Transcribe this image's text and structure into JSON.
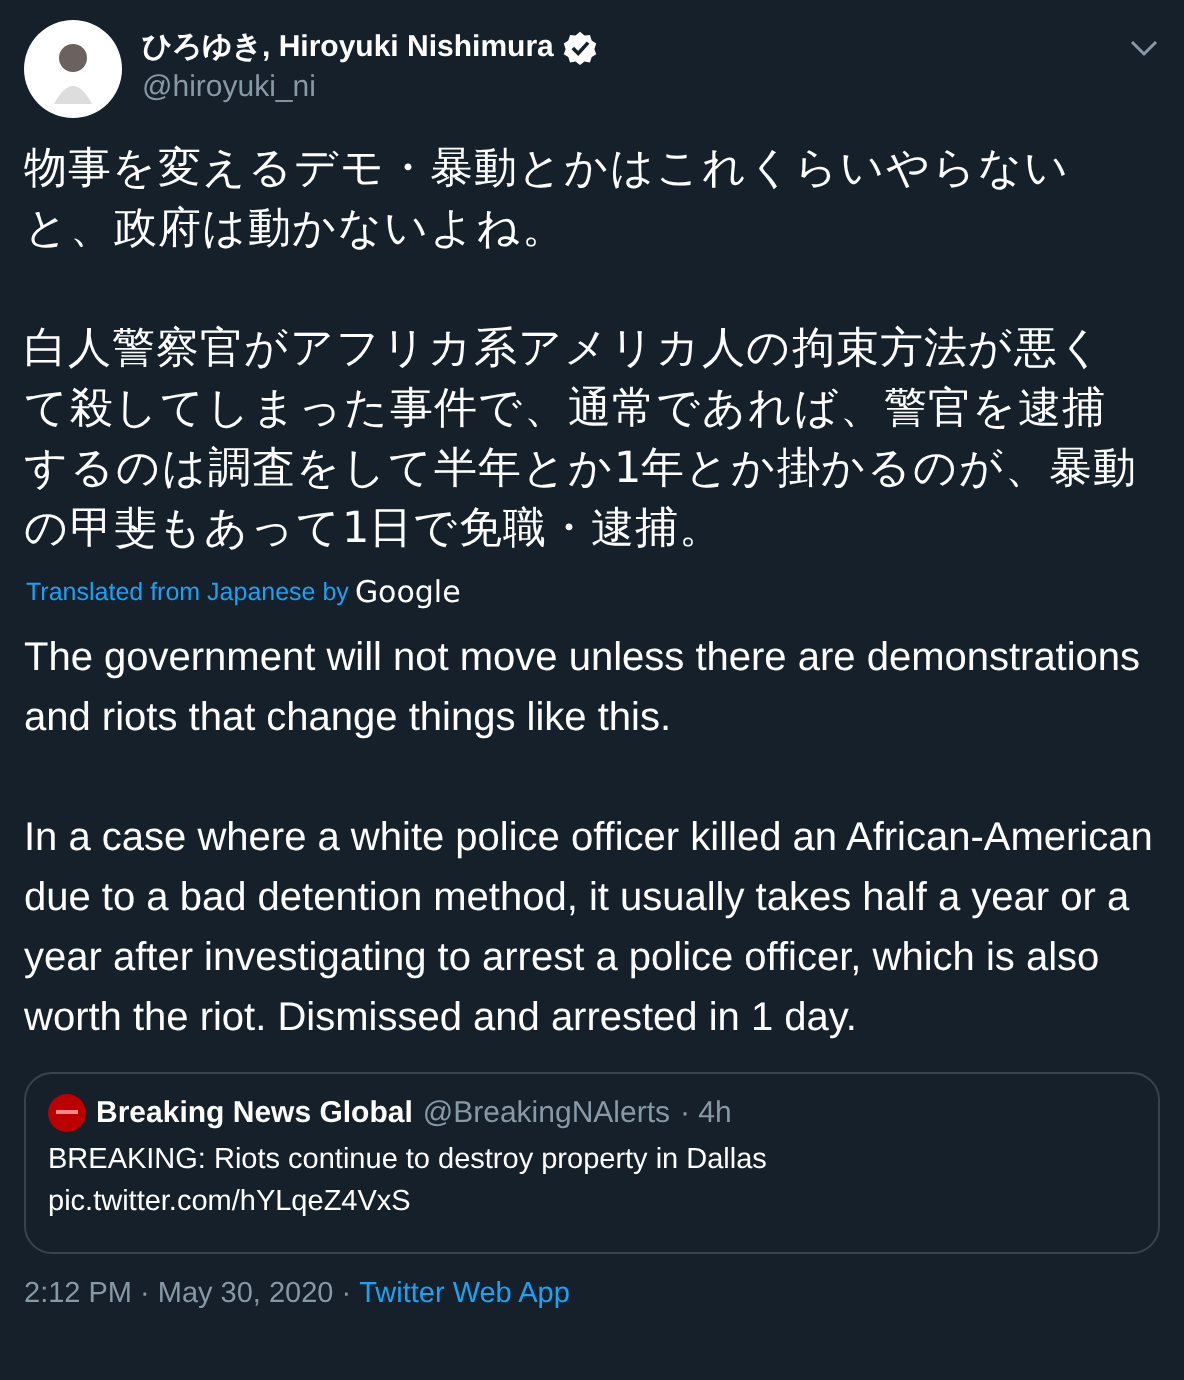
{
  "author": {
    "name": "ひろゆき, Hiroyuki Nishimura",
    "verified": true,
    "handle": "@hiroyuki_ni"
  },
  "text": [
    "物事を変えるデモ・暴動とかはこれくらいやらないと、政府は動かないよね。",
    "白人警察官がアフリカ系アメリカ人の拘束方法が悪くて殺してしまった事件で、通常であれば、警官を逮捕するのは調査をして半年とか1年とか掛かるのが、暴動の甲斐もあって1日で免職・逮捕。"
  ],
  "translation": {
    "note": "Translated from Japanese by",
    "provider": "Google"
  },
  "translated_text": [
    "The government will not move unless there are demonstrations and riots that change things like this.",
    "In a case where a white police officer killed an African-American due to a bad detention method, it usually takes half a year or a year after investigating to arrest a police officer, which is also worth the riot. Dismissed and arrested in 1 day."
  ],
  "quoted_tweet": {
    "name": "Breaking News Global",
    "handle": "@BreakingNAlerts",
    "time": "· 4h",
    "text": "BREAKING: Riots continue to destroy property in Dallas",
    "link": "pic.twitter.com/hYLqeZ4VxS"
  },
  "footer": {
    "timestamp": "2:12 PM · May 30, 2020",
    "separator": "·",
    "source": "Twitter Web App"
  }
}
